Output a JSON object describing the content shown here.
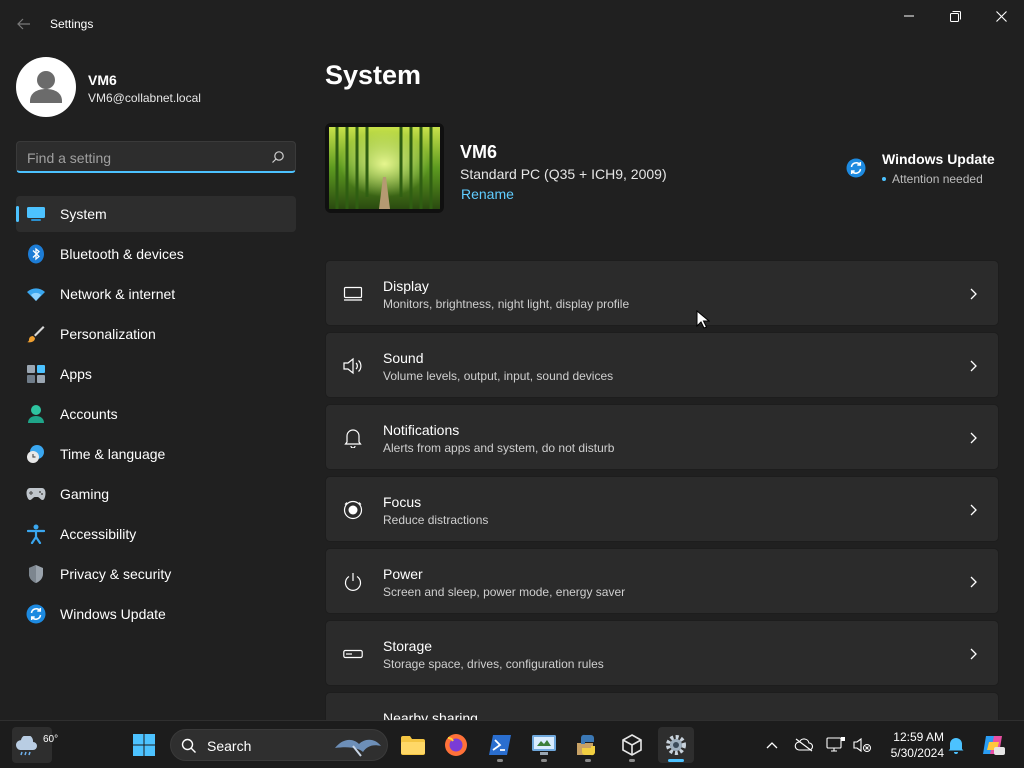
{
  "window": {
    "title": "Settings"
  },
  "profile": {
    "name": "VM6",
    "email": "VM6@collabnet.local"
  },
  "search": {
    "placeholder": "Find a setting"
  },
  "sidebar": {
    "items": [
      {
        "label": "System",
        "icon": "system-icon",
        "active": true
      },
      {
        "label": "Bluetooth & devices",
        "icon": "bluetooth-icon"
      },
      {
        "label": "Network & internet",
        "icon": "wifi-icon"
      },
      {
        "label": "Personalization",
        "icon": "brush-icon"
      },
      {
        "label": "Apps",
        "icon": "apps-icon"
      },
      {
        "label": "Accounts",
        "icon": "accounts-icon"
      },
      {
        "label": "Time & language",
        "icon": "clock-globe-icon"
      },
      {
        "label": "Gaming",
        "icon": "gamepad-icon"
      },
      {
        "label": "Accessibility",
        "icon": "accessibility-icon"
      },
      {
        "label": "Privacy & security",
        "icon": "shield-icon"
      },
      {
        "label": "Windows Update",
        "icon": "update-icon"
      }
    ]
  },
  "main": {
    "title": "System",
    "device": {
      "name": "VM6",
      "model": "Standard PC (Q35 + ICH9, 2009)",
      "rename_label": "Rename"
    },
    "windows_update": {
      "title": "Windows Update",
      "status": "Attention needed"
    },
    "cards": [
      {
        "title": "Display",
        "desc": "Monitors, brightness, night light, display profile",
        "icon": "monitor-icon"
      },
      {
        "title": "Sound",
        "desc": "Volume levels, output, input, sound devices",
        "icon": "speaker-icon"
      },
      {
        "title": "Notifications",
        "desc": "Alerts from apps and system, do not disturb",
        "icon": "bell-icon"
      },
      {
        "title": "Focus",
        "desc": "Reduce distractions",
        "icon": "focus-icon"
      },
      {
        "title": "Power",
        "desc": "Screen and sleep, power mode, energy saver",
        "icon": "power-icon"
      },
      {
        "title": "Storage",
        "desc": "Storage space, drives, configuration rules",
        "icon": "storage-icon"
      },
      {
        "title": "Nearby sharing",
        "desc": "",
        "icon": "share-icon"
      }
    ]
  },
  "taskbar": {
    "weather_temp": "60°",
    "search_label": "Search",
    "clock_time": "12:59 AM",
    "clock_date": "5/30/2024"
  },
  "colors": {
    "accent": "#4cc2ff",
    "link": "#60cdff",
    "background": "#202020",
    "card": "#2b2b2b"
  }
}
